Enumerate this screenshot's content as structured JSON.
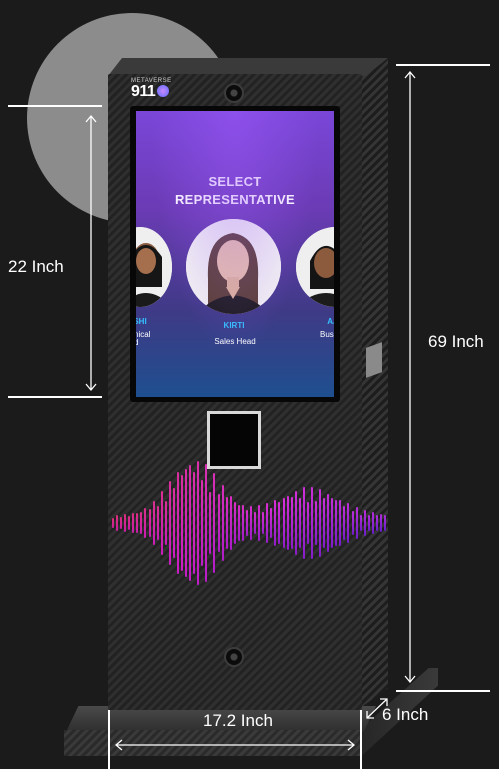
{
  "brand": {
    "small_text": "METAVERSE",
    "number": "911",
    "accent": "#8a6bff"
  },
  "screen": {
    "title_line1": "SELECT",
    "title_line2": "REPRESENTATIVE",
    "representatives": [
      {
        "name": "SHI",
        "role_line1": "nical",
        "role_line2": "d"
      },
      {
        "name": "KIRTI",
        "role_line1": "Sales Head",
        "role_line2": ""
      },
      {
        "name": "AA",
        "role_line1": "Busi",
        "role_line2": ""
      }
    ],
    "name_color": "#33c1ff",
    "gradient_top": "#7a46d8",
    "gradient_bottom": "#1e4f8f"
  },
  "dimensions": {
    "screen_height": "22 Inch",
    "total_height": "69 Inch",
    "width": "17.2 Inch",
    "depth": "6 Inch"
  },
  "icons": [
    "camera-icon",
    "fingerprint-reader-icon",
    "waveform-graphic",
    "dimension-arrow-icon"
  ]
}
